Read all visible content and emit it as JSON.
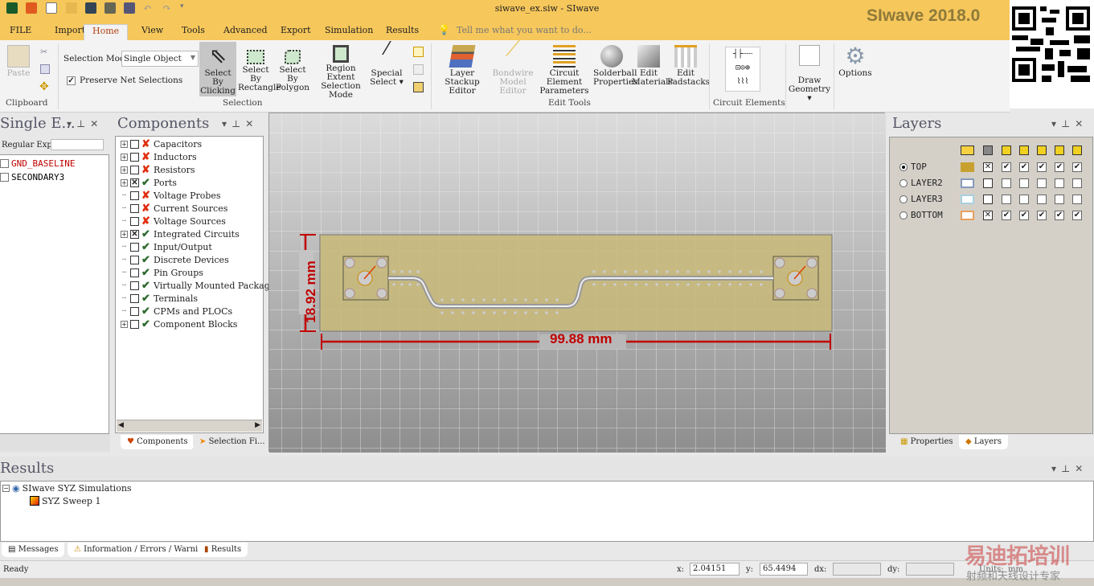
{
  "window": {
    "title": "siwave_ex.siw - SIwave",
    "brand": "SIwave 2018.0"
  },
  "menu": {
    "tabs": [
      "FILE",
      "Import",
      "Home",
      "View",
      "Tools",
      "Advanced",
      "Export",
      "Simulation",
      "Results"
    ],
    "active": "Home",
    "tell_me": "Tell me what you want to do..."
  },
  "ribbon": {
    "clipboard": {
      "paste": "Paste",
      "group": "Clipboard"
    },
    "selection": {
      "mode_label": "Selection Mode:",
      "mode_value": "Single Object",
      "preserve": "Preserve Net Selections",
      "by_clicking": [
        "Select By",
        "Clicking"
      ],
      "by_rectangle": [
        "Select By",
        "Rectangle"
      ],
      "by_polygon": [
        "Select By",
        "Polygon"
      ],
      "region": [
        "Region Extent",
        "Selection Mode"
      ],
      "special": [
        "Special",
        "Select ▾"
      ],
      "group": "Selection"
    },
    "edit_tools": {
      "stackup": [
        "Layer Stackup",
        "Editor"
      ],
      "bondwire": [
        "Bondwire",
        "Model Editor"
      ],
      "circuit": [
        "Circuit Element",
        "Parameters"
      ],
      "solderball": [
        "Solderball",
        "Properties"
      ],
      "materials": [
        "Edit",
        "Materials"
      ],
      "padstacks": [
        "Edit",
        "Padstacks"
      ],
      "group": "Edit Tools"
    },
    "circuit_elements": {
      "group": "Circuit Elements"
    },
    "draw": [
      "Draw",
      "Geometry ▾"
    ],
    "options": "Options"
  },
  "single_panel": {
    "title": "Single E...",
    "regex_label": "Regular Exp:",
    "regex_value": "",
    "nets": [
      {
        "name": "GND_BASELINE",
        "color": "#c00000"
      },
      {
        "name": "SECONDARY3",
        "color": "#000000"
      }
    ]
  },
  "components": {
    "title": "Components",
    "items": [
      {
        "label": "Capacitors",
        "expand": true,
        "checked": false,
        "ok": false
      },
      {
        "label": "Inductors",
        "expand": true,
        "checked": false,
        "ok": false
      },
      {
        "label": "Resistors",
        "expand": true,
        "checked": false,
        "ok": false
      },
      {
        "label": "Ports",
        "expand": true,
        "checked": true,
        "ok": true
      },
      {
        "label": "Voltage Probes",
        "expand": false,
        "checked": false,
        "ok": false
      },
      {
        "label": "Current Sources",
        "expand": false,
        "checked": false,
        "ok": false
      },
      {
        "label": "Voltage Sources",
        "expand": false,
        "checked": false,
        "ok": false
      },
      {
        "label": "Integrated Circuits",
        "expand": true,
        "checked": true,
        "ok": true
      },
      {
        "label": "Input/Output",
        "expand": false,
        "checked": false,
        "ok": true
      },
      {
        "label": "Discrete Devices",
        "expand": false,
        "checked": false,
        "ok": true
      },
      {
        "label": "Pin Groups",
        "expand": false,
        "checked": false,
        "ok": true
      },
      {
        "label": "Virtually Mounted Package",
        "expand": false,
        "checked": false,
        "ok": true
      },
      {
        "label": "Terminals",
        "expand": false,
        "checked": false,
        "ok": true
      },
      {
        "label": "CPMs and PLOCs",
        "expand": false,
        "checked": false,
        "ok": true
      },
      {
        "label": "Component Blocks",
        "expand": true,
        "checked": false,
        "ok": true
      }
    ],
    "tabs": [
      "Components",
      "Selection Fi..."
    ]
  },
  "canvas": {
    "width_dim": "99.88 mm",
    "height_dim": "18.92 mm",
    "board_color": "#c8b878",
    "dim_color": "#c00000"
  },
  "layers": {
    "title": "Layers",
    "rows": [
      {
        "name": "TOP",
        "selected": true,
        "color": "#c8a030",
        "visible": true,
        "checks": [
          true,
          true,
          true,
          true,
          true
        ]
      },
      {
        "name": "LAYER2",
        "selected": false,
        "color": "#8899bb",
        "visible": false,
        "checks": [
          false,
          false,
          false,
          false,
          false
        ]
      },
      {
        "name": "LAYER3",
        "selected": false,
        "color": "#a8d0e0",
        "visible": false,
        "checks": [
          false,
          false,
          false,
          false,
          false
        ]
      },
      {
        "name": "BOTTOM",
        "selected": false,
        "color": "#e8a060",
        "visible": true,
        "checks": [
          true,
          true,
          true,
          true,
          true
        ]
      }
    ],
    "tabs": [
      "Properties",
      "Layers"
    ]
  },
  "results": {
    "title": "Results",
    "root": "SIwave SYZ Simulations",
    "child": "SYZ Sweep 1",
    "tabs": [
      "Messages",
      "Information / Errors / Warnings",
      "Results"
    ]
  },
  "status": {
    "text": "Ready",
    "x_label": "x:",
    "x": "2.04151",
    "y_label": "y:",
    "y": "65.4494",
    "dx_label": "dx:",
    "dy_label": "dy:",
    "units_label": "Units:",
    "units": "mm"
  },
  "watermark": {
    "line1": "易迪拓培训",
    "line2": "射频和天线设计专家"
  }
}
